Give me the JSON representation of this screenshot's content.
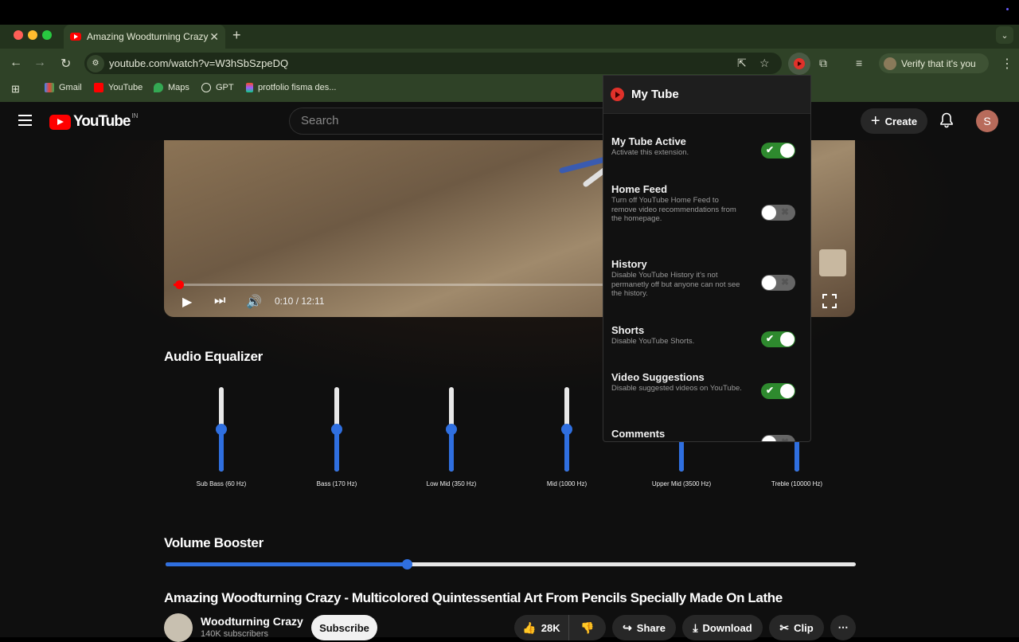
{
  "browser": {
    "tab_title": "Amazing Woodturning Crazy",
    "url": "youtube.com/watch?v=W3hSbSzpeDQ",
    "verify_label": "Verify that it's you",
    "bookmarks": [
      "Gmail",
      "YouTube",
      "Maps",
      "GPT",
      "protfolio fisma des..."
    ]
  },
  "youtube": {
    "logo_text": "YouTube",
    "logo_region": "IN",
    "search_placeholder": "Search",
    "create_label": "Create",
    "avatar_initial": "S"
  },
  "player": {
    "time": "0:10 / 12:11",
    "progress_fraction": 0.0137
  },
  "equalizer": {
    "heading": "Audio Equalizer",
    "bands": [
      {
        "label": "Sub Bass (60 Hz)",
        "level": 0.5
      },
      {
        "label": "Bass (170 Hz)",
        "level": 0.5
      },
      {
        "label": "Low Mid (350 Hz)",
        "level": 0.5
      },
      {
        "label": "Mid (1000 Hz)",
        "level": 0.5
      },
      {
        "label": "Upper Mid (3500 Hz)",
        "level": 0.5
      },
      {
        "label": "Treble (10000 Hz)",
        "level": 0.5
      }
    ]
  },
  "volume_booster": {
    "heading": "Volume Booster",
    "level": 0.35
  },
  "video": {
    "title": "Amazing Woodturning Crazy - Multicolored Quintessential Art From Pencils Specially Made On Lathe",
    "channel": "Woodturning Crazy",
    "subscribers": "140K subscribers",
    "subscribe_label": "Subscribe",
    "likes": "28K",
    "share_label": "Share",
    "download_label": "Download",
    "clip_label": "Clip"
  },
  "extension": {
    "title": "My Tube",
    "options": [
      {
        "title": "My Tube Active",
        "desc": "Activate this extension.",
        "on": true
      },
      {
        "title": "Home Feed",
        "desc": "Turn off YouTube Home Feed to remove video recommendations from the homepage.",
        "on": false
      },
      {
        "title": "History",
        "desc": "Disable YouTube History it's not permanetly off but anyone can not see the history.",
        "on": false
      },
      {
        "title": "Shorts",
        "desc": "Disable YouTube Shorts.",
        "on": true
      },
      {
        "title": "Video Suggestions",
        "desc": "Disable suggested videos on YouTube.",
        "on": true
      },
      {
        "title": "Comments",
        "desc": "",
        "on": false
      }
    ]
  },
  "colors": {
    "accent_blue": "#2f6fe0",
    "toggle_on": "#2e8a2e",
    "youtube_red": "#ff0000",
    "browser_green": "#2f4227"
  }
}
